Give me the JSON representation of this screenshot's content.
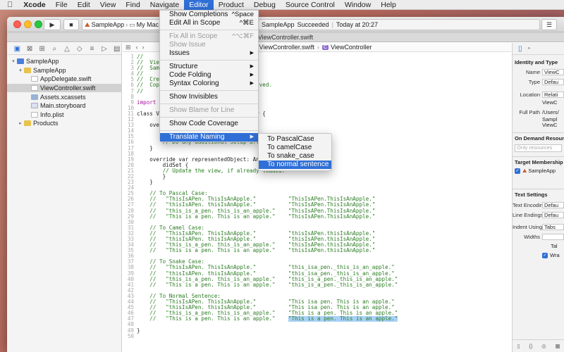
{
  "menubar": {
    "apple": "",
    "items": [
      "Xcode",
      "File",
      "Edit",
      "View",
      "Find",
      "Navigate",
      "Editor",
      "Product",
      "Debug",
      "Source Control",
      "Window",
      "Help"
    ]
  },
  "toolbar": {
    "scheme_app": "SampleApp",
    "scheme_device": "My Mac",
    "status_app": "SampleApp",
    "status_text": "Succeeded",
    "status_time": "Today at 20:27"
  },
  "tab_title": "ViewController.swift",
  "jumpbar": {
    "file": "ViewController.swift",
    "symbol": "ViewController"
  },
  "navigator": {
    "tree": [
      {
        "label": "SampleApp",
        "indent": 0,
        "disclosure": "▾",
        "icon": "fi-proj",
        "selected": false
      },
      {
        "label": "SampleApp",
        "indent": 1,
        "disclosure": "▾",
        "icon": "fi-folder",
        "selected": false
      },
      {
        "label": "AppDelegate.swift",
        "indent": 2,
        "disclosure": "",
        "icon": "fi-swift",
        "selected": false
      },
      {
        "label": "ViewController.swift",
        "indent": 2,
        "disclosure": "",
        "icon": "fi-swift",
        "selected": true
      },
      {
        "label": "Assets.xcassets",
        "indent": 2,
        "disclosure": "",
        "icon": "fi-assets",
        "selected": false
      },
      {
        "label": "Main.storyboard",
        "indent": 2,
        "disclosure": "",
        "icon": "fi-board",
        "selected": false
      },
      {
        "label": "Info.plist",
        "indent": 2,
        "disclosure": "",
        "icon": "fi-plist",
        "selected": false
      },
      {
        "label": "Products",
        "indent": 1,
        "disclosure": "▸",
        "icon": "fi-folder",
        "selected": false
      }
    ]
  },
  "editor_menu": {
    "items": [
      {
        "type": "item",
        "label": "Show Completions",
        "shortcut": "^Space",
        "disabled": false,
        "submenu": false,
        "active": false
      },
      {
        "type": "item",
        "label": "Edit All in Scope",
        "shortcut": "^⌘E",
        "disabled": false,
        "submenu": false,
        "active": false
      },
      {
        "type": "sep"
      },
      {
        "type": "item",
        "label": "Fix All in Scope",
        "shortcut": "^⌥⌘F",
        "disabled": true,
        "submenu": false,
        "active": false
      },
      {
        "type": "item",
        "label": "Show Issue",
        "shortcut": "",
        "disabled": true,
        "submenu": false,
        "active": false
      },
      {
        "type": "item",
        "label": "Issues",
        "shortcut": "▶",
        "disabled": false,
        "submenu": true,
        "active": false
      },
      {
        "type": "sep"
      },
      {
        "type": "item",
        "label": "Structure",
        "shortcut": "▶",
        "disabled": false,
        "submenu": true,
        "active": false
      },
      {
        "type": "item",
        "label": "Code Folding",
        "shortcut": "▶",
        "disabled": false,
        "submenu": true,
        "active": false
      },
      {
        "type": "item",
        "label": "Syntax Coloring",
        "shortcut": "▶",
        "disabled": false,
        "submenu": true,
        "active": false
      },
      {
        "type": "sep"
      },
      {
        "type": "item",
        "label": "Show Invisibles",
        "shortcut": "",
        "disabled": false,
        "submenu": false,
        "active": false
      },
      {
        "type": "sep"
      },
      {
        "type": "item",
        "label": "Show Blame for Line",
        "shortcut": "",
        "disabled": true,
        "submenu": false,
        "active": false
      },
      {
        "type": "sep"
      },
      {
        "type": "item",
        "label": "Show Code Coverage",
        "shortcut": "",
        "disabled": false,
        "submenu": false,
        "active": false
      },
      {
        "type": "sep"
      },
      {
        "type": "item",
        "label": "Translate Naming",
        "shortcut": "▶",
        "disabled": false,
        "submenu": true,
        "active": true
      }
    ]
  },
  "translate_submenu": {
    "items": [
      {
        "label": "To PascalCase",
        "active": false
      },
      {
        "label": "To camelCase",
        "active": false
      },
      {
        "label": "To snake_case",
        "active": false
      },
      {
        "label": "To normal sentence",
        "active": true
      }
    ]
  },
  "code": [
    {
      "n": "1",
      "t": "//",
      "c": "com"
    },
    {
      "n": "2",
      "t": "//  ViewController.swift",
      "c": "com"
    },
    {
      "n": "3",
      "t": "//  SampleApp",
      "c": "com"
    },
    {
      "n": "4",
      "t": "//",
      "c": "com"
    },
    {
      "n": "5",
      "t": "//  Created on 2018/03/21.",
      "c": "com"
    },
    {
      "n": "6",
      "t": "//  Copyright © 2018. All rights reserved.",
      "c": "com"
    },
    {
      "n": "7",
      "t": "//",
      "c": "com"
    },
    {
      "n": "8",
      "t": "",
      "c": ""
    },
    {
      "n": "9",
      "t": "import Cocoa",
      "c": "kw"
    },
    {
      "n": "10",
      "t": "",
      "c": ""
    },
    {
      "n": "11",
      "t": "class ViewController: NSViewController {",
      "c": ""
    },
    {
      "n": "12",
      "t": "",
      "c": ""
    },
    {
      "n": "13",
      "t": "    override func viewDidLoad() {",
      "c": ""
    },
    {
      "n": "14",
      "t": "        super.viewDidLoad()",
      "c": ""
    },
    {
      "n": "15",
      "t": "",
      "c": ""
    },
    {
      "n": "16",
      "t": "        // Do any additional setup after loading the view.",
      "c": "com"
    },
    {
      "n": "17",
      "t": "    }",
      "c": ""
    },
    {
      "n": "18",
      "t": "",
      "c": ""
    },
    {
      "n": "19",
      "t": "    override var representedObject: Any? {",
      "c": ""
    },
    {
      "n": "20",
      "t": "        didSet {",
      "c": ""
    },
    {
      "n": "21",
      "t": "        // Update the view, if already loaded.",
      "c": "com"
    },
    {
      "n": "22",
      "t": "        }",
      "c": ""
    },
    {
      "n": "23",
      "t": "    }",
      "c": ""
    },
    {
      "n": "24",
      "t": "",
      "c": ""
    },
    {
      "n": "25",
      "t": "    // To Pascal Case:",
      "c": "com"
    },
    {
      "n": "26",
      "t": "    //   \"ThisIsAPen. ThisIsAnApple.\"          \"ThisIsAPen.ThisIsAnApple.\"",
      "c": "com"
    },
    {
      "n": "27",
      "t": "    //   \"thisIsAPen. thisIsAnApple.\"          \"ThisIsAPen.ThisIsAnApple.\"",
      "c": "com"
    },
    {
      "n": "28",
      "t": "    //   \"this_is_a_pen. this_is_an_apple.\"    \"ThisIsAPen.ThisIsAnApple.\"",
      "c": "com"
    },
    {
      "n": "29",
      "t": "    //   \"This is a pen. This is an apple.\"    \"ThisIsAPen.ThisIsAnApple.\"",
      "c": "com"
    },
    {
      "n": "30",
      "t": "",
      "c": ""
    },
    {
      "n": "31",
      "t": "    // To Camel Case:",
      "c": "com"
    },
    {
      "n": "32",
      "t": "    //   \"ThisIsAPen. ThisIsAnApple.\"          \"thisIsAPen.thisIsAnApple.\"",
      "c": "com"
    },
    {
      "n": "33",
      "t": "    //   \"thisIsAPen. thisIsAnApple.\"          \"thisIsAPen.thisIsAnApple.\"",
      "c": "com"
    },
    {
      "n": "34",
      "t": "    //   \"this_is_a_pen. this_is_an_apple.\"    \"thisIsAPen.thisIsAnApple.\"",
      "c": "com"
    },
    {
      "n": "35",
      "t": "    //   \"This is a pen. This is an apple.\"    \"thisIsAPen.thisIsAnApple.\"",
      "c": "com"
    },
    {
      "n": "36",
      "t": "",
      "c": ""
    },
    {
      "n": "37",
      "t": "    // To Snake Case:",
      "c": "com"
    },
    {
      "n": "38",
      "t": "    //   \"ThisIsAPen. ThisIsAnApple.\"          \"this_isa_pen._this_is_an_apple.\"",
      "c": "com"
    },
    {
      "n": "39",
      "t": "    //   \"thisIsAPen. thisIsAnApple.\"          \"this_isa_pen._this_is_an_apple.\"",
      "c": "com"
    },
    {
      "n": "40",
      "t": "    //   \"this_is_a_pen. this_is_an_apple.\"    \"this_is_a_pen._this_is_an_apple.\"",
      "c": "com"
    },
    {
      "n": "41",
      "t": "    //   \"This is a pen. This is an apple.\"    \"this_is_a_pen._this_is_an_apple.\"",
      "c": "com"
    },
    {
      "n": "42",
      "t": "",
      "c": ""
    },
    {
      "n": "43",
      "t": "    // To Normal Sentence:",
      "c": "com"
    },
    {
      "n": "44",
      "t": "    //   \"ThisIsAPen. ThisIsAnApple.\"          \"This isa pen. This is an apple.\"",
      "c": "com"
    },
    {
      "n": "45",
      "t": "    //   \"thisIsAPen. thisIsAnApple.\"          \"This isa pen. This is an apple.\"",
      "c": "com"
    },
    {
      "n": "46",
      "t": "    //   \"this_is_a_pen. this_is_an_apple.\"    \"This is a pen. This is an apple.\"",
      "c": "com"
    },
    {
      "n": "47",
      "t": "    //   \"This is a pen. This is an apple.\"    ",
      "c": "com",
      "hl": "\"This is a pen. This is an apple.\""
    },
    {
      "n": "48",
      "t": "",
      "c": ""
    },
    {
      "n": "49",
      "t": "}",
      "c": ""
    },
    {
      "n": "50",
      "t": "",
      "c": ""
    }
  ],
  "inspector": {
    "identity_heading": "Identity and Type",
    "name_label": "Name",
    "name_value": "ViewC",
    "type_label": "Type",
    "type_value": "Defau",
    "location_label": "Location",
    "location_value": "Relati",
    "location_sub": "ViewC",
    "fullpath_label": "Full Path",
    "fullpath_lines": [
      "/Users/",
      "Sampl",
      "ViewC"
    ],
    "ondemand_heading": "On Demand Resource T",
    "ondemand_placeholder": "Only resources are t",
    "target_heading": "Target Membership",
    "target_name": "SampleApp",
    "textsettings_heading": "Text Settings",
    "encoding_label": "Text Encoding",
    "encoding_value": "Defau",
    "lineendings_label": "Line Endings",
    "lineendings_value": "Defau",
    "indent_label": "Indent Using",
    "indent_value": "Tabs",
    "widths_label": "Widths",
    "tab_label": "Tal",
    "wrap_label": "Wra"
  },
  "colors": {
    "accent": "#2f6fd6",
    "highlight": "#a8d1f7"
  }
}
